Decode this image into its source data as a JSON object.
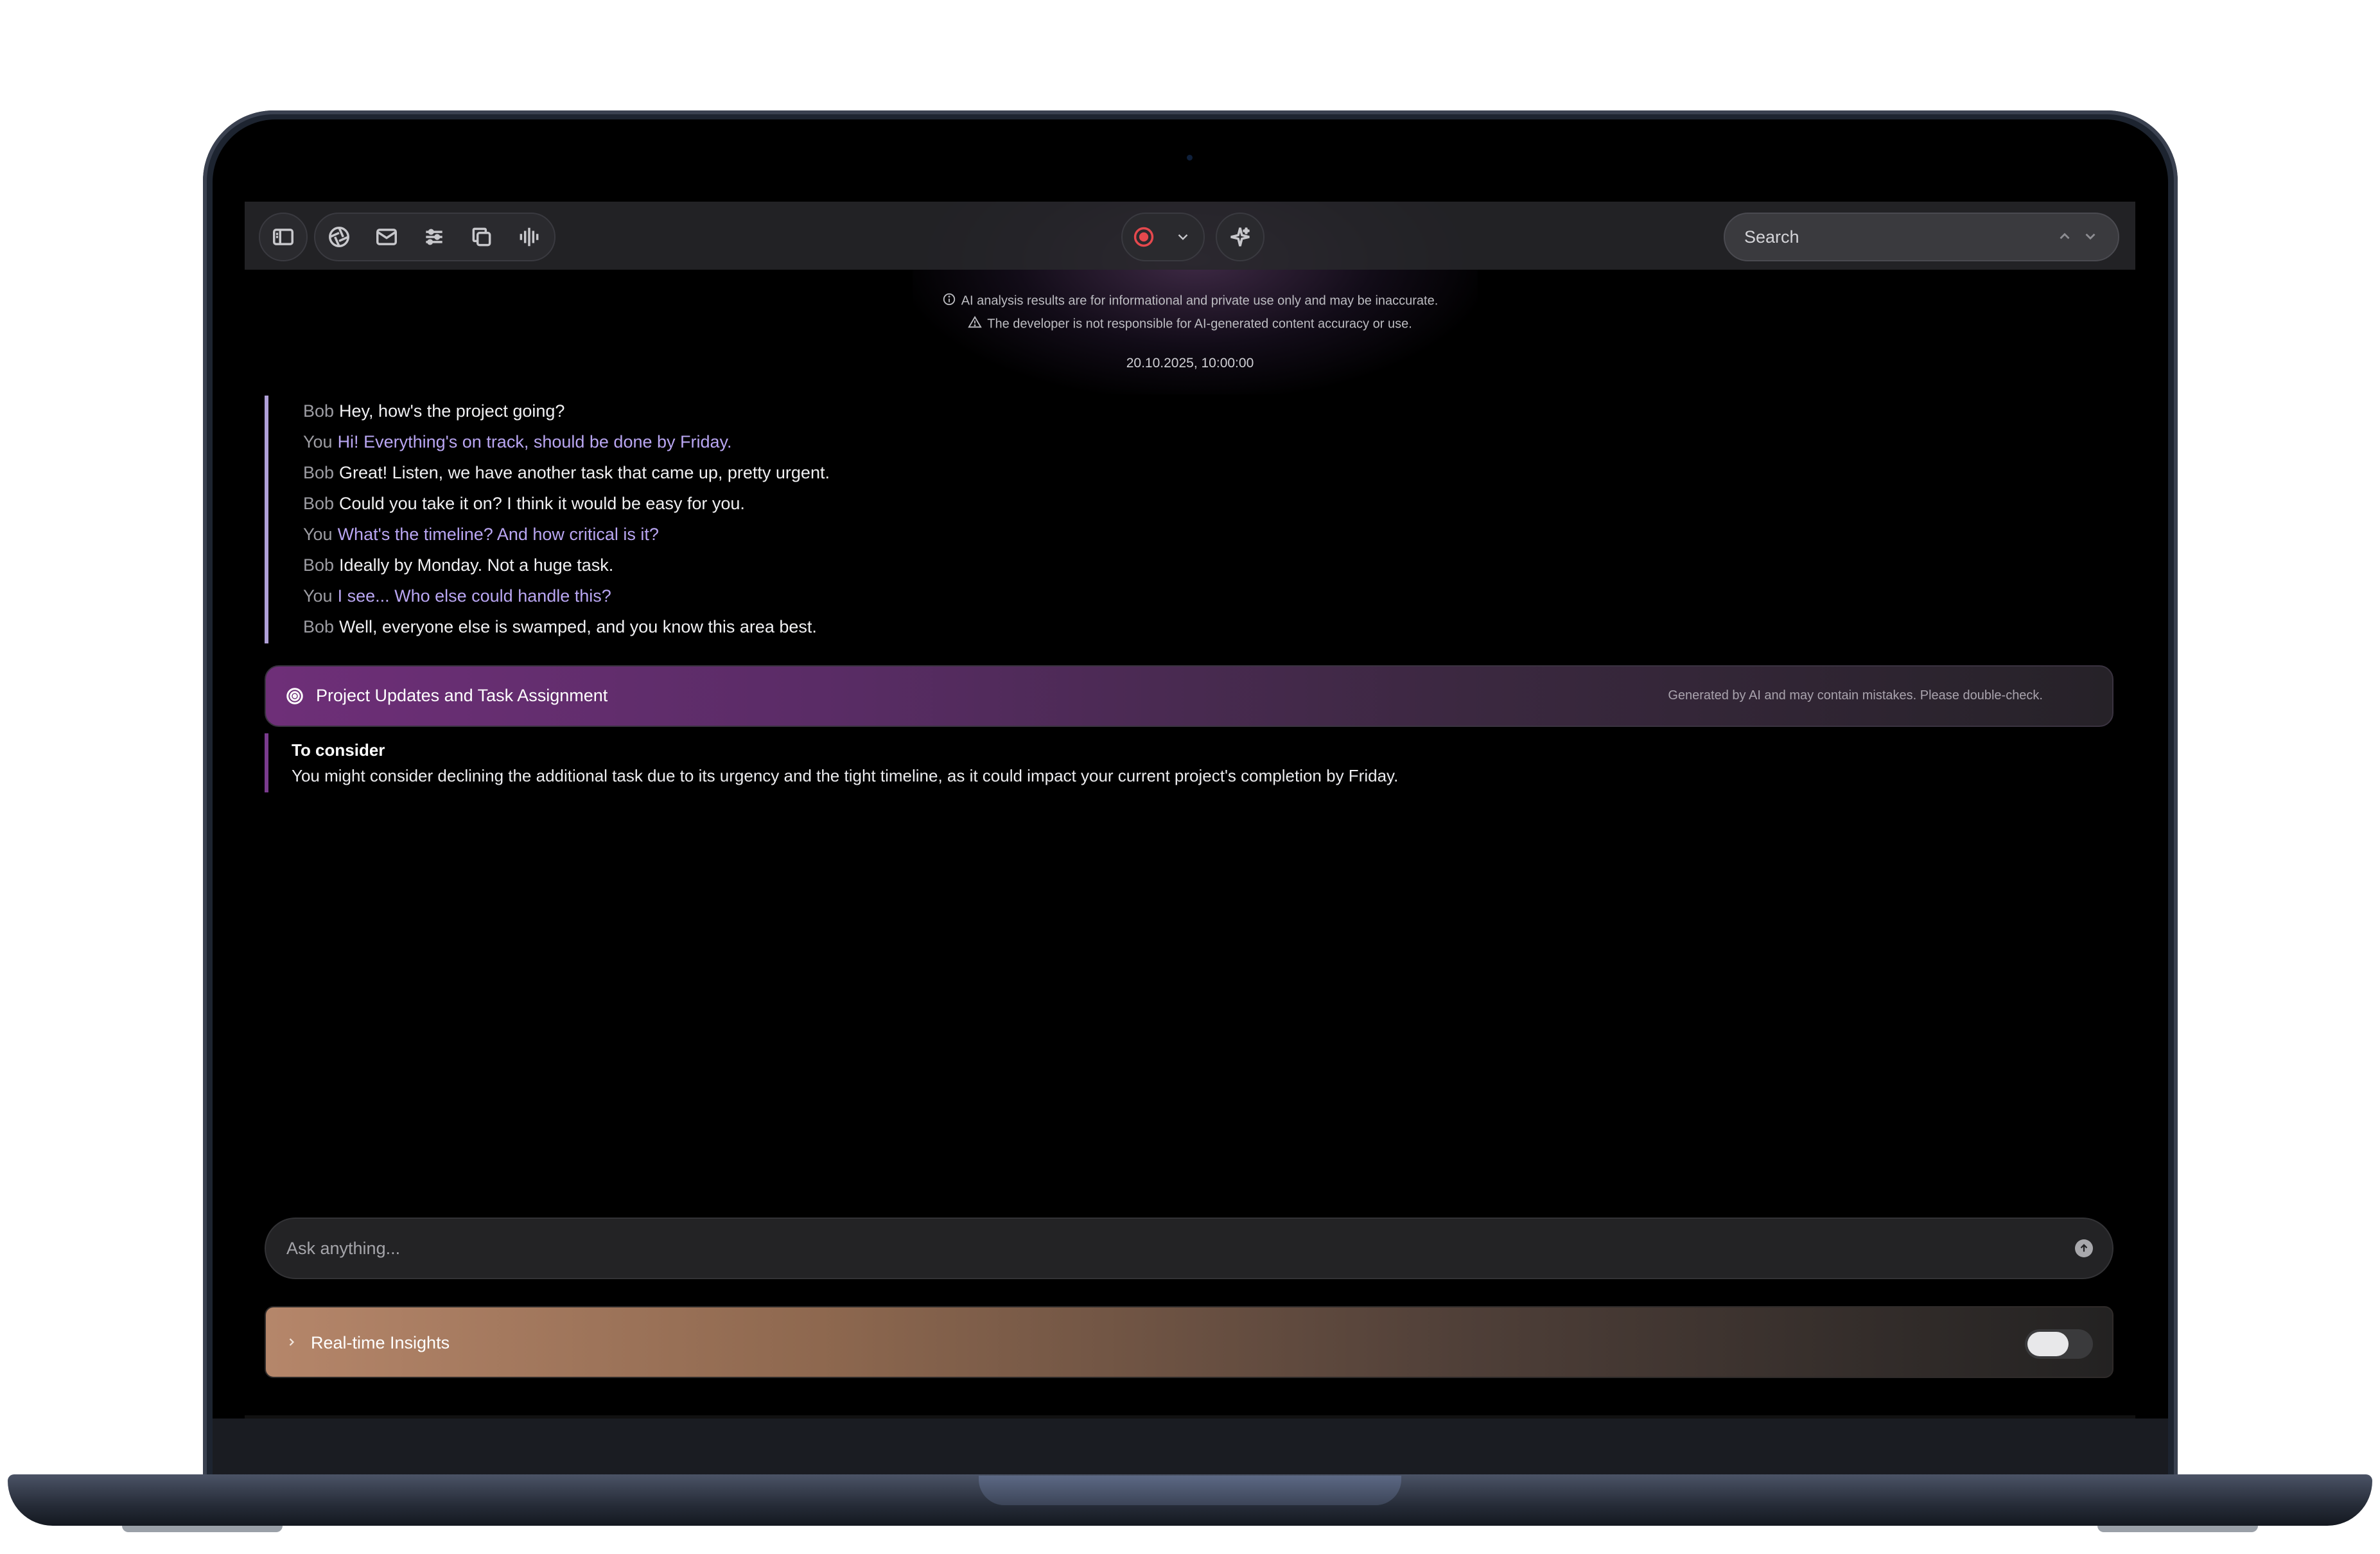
{
  "toolbar": {
    "left_icons": [
      "sidebar-icon",
      "aperture-icon",
      "mail-icon",
      "sliders-icon",
      "copy-icon",
      "waveform-icon"
    ],
    "record_color": "#e5484d",
    "search_placeholder": "Search"
  },
  "notices": [
    {
      "icon": "info-icon",
      "text": "AI analysis results are for informational and private use only and may be inaccurate."
    },
    {
      "icon": "warning-icon",
      "text": "The developer is not responsible for AI-generated content accuracy or use."
    }
  ],
  "timestamp": "20.10.2025, 10:00:00",
  "transcript": [
    {
      "speaker": "Bob",
      "text": "Hey, how's the project going?"
    },
    {
      "speaker": "You",
      "text": "Hi! Everything's on track, should be done by Friday."
    },
    {
      "speaker": "Bob",
      "text": "Great! Listen, we have another task that came up, pretty urgent."
    },
    {
      "speaker": "Bob",
      "text": "Could you take it on? I think it would be easy for you."
    },
    {
      "speaker": "You",
      "text": "What's the timeline? And how critical is it?"
    },
    {
      "speaker": "Bob",
      "text": "Ideally by Monday. Not a huge task."
    },
    {
      "speaker": "You",
      "text": "I see... Who else could handle this?"
    },
    {
      "speaker": "Bob",
      "text": "Well, everyone else is swamped, and you know this area best."
    }
  ],
  "summary": {
    "title": "Project Updates and Task Assignment",
    "note": "Generated by AI and may contain mistakes. Please double-check."
  },
  "consider": {
    "title": "To consider",
    "body": "You might consider declining the additional task due to its urgency and the tight timeline, as it could impact your current project's completion by Friday."
  },
  "ask": {
    "placeholder": "Ask anything..."
  },
  "insights": {
    "title": "Real-time Insights",
    "enabled": false
  },
  "colors": {
    "you_text": "#b9a6f2",
    "summary_accent": "#6e2f78",
    "insights_accent": "#b5866a"
  }
}
